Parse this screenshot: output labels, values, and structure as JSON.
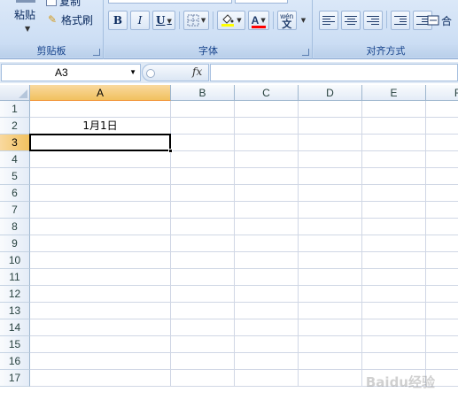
{
  "ribbon": {
    "clipboard": {
      "paste_label": "粘贴",
      "copy_label": "复制",
      "format_painter_label": "格式刷",
      "group_label": "剪贴板"
    },
    "font": {
      "bold_label": "B",
      "italic_label": "I",
      "underline_label": "U",
      "font_color_label": "A",
      "wen_label": "wén",
      "group_label": "字体",
      "fill_color": "#ffff00",
      "font_color": "#ff0000"
    },
    "alignment": {
      "merge_label": "合",
      "group_label": "对齐方式"
    }
  },
  "formula_bar": {
    "name_box": "A3",
    "fx_label": "fx",
    "formula": ""
  },
  "grid": {
    "columns": [
      "A",
      "B",
      "C",
      "D",
      "E",
      "F"
    ],
    "rows": [
      "1",
      "2",
      "3",
      "4",
      "5",
      "6",
      "7",
      "8",
      "9",
      "10",
      "11",
      "12",
      "13",
      "14",
      "15",
      "16",
      "17"
    ],
    "active_cell": "A3",
    "cells": {
      "A2": "1月1日"
    }
  },
  "watermark": "Baidu经验"
}
